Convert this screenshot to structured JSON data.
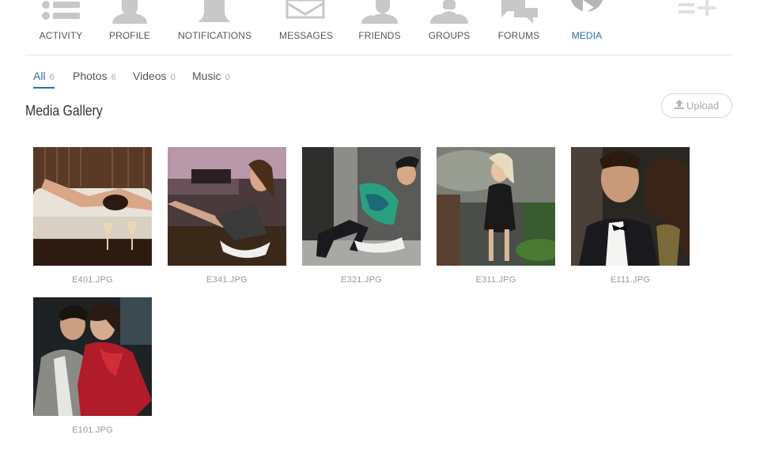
{
  "nav": {
    "items": [
      {
        "label": "ACTIVITY",
        "icon": "activity-list-icon"
      },
      {
        "label": "PROFILE",
        "icon": "profile-user-icon"
      },
      {
        "label": "NOTIFICATIONS",
        "icon": "bell-icon"
      },
      {
        "label": "MESSAGES",
        "icon": "envelope-icon"
      },
      {
        "label": "FRIENDS",
        "icon": "friends-icon"
      },
      {
        "label": "GROUPS",
        "icon": "groups-icon"
      },
      {
        "label": "FORUMS",
        "icon": "forum-bubbles-icon"
      },
      {
        "label": "MEDIA",
        "icon": "play-circle-icon"
      }
    ],
    "extra_icon": "add-list-icon",
    "active": "MEDIA",
    "icon_color": "#c8c8c8",
    "active_color": "#2e6ea6"
  },
  "tabs": [
    {
      "label": "All",
      "count": "6"
    },
    {
      "label": "Photos",
      "count": "6"
    },
    {
      "label": "Videos",
      "count": "0"
    },
    {
      "label": "Music",
      "count": "0"
    }
  ],
  "gallery": {
    "title": "Media Gallery",
    "upload_label": "Upload",
    "upload_icon": "upload-icon",
    "items": [
      {
        "filename": "E401.JPG"
      },
      {
        "filename": "E341.JPG"
      },
      {
        "filename": "E321.JPG"
      },
      {
        "filename": "E311.JPG"
      },
      {
        "filename": "E111.JPG"
      },
      {
        "filename": "E101.JPG"
      }
    ]
  }
}
